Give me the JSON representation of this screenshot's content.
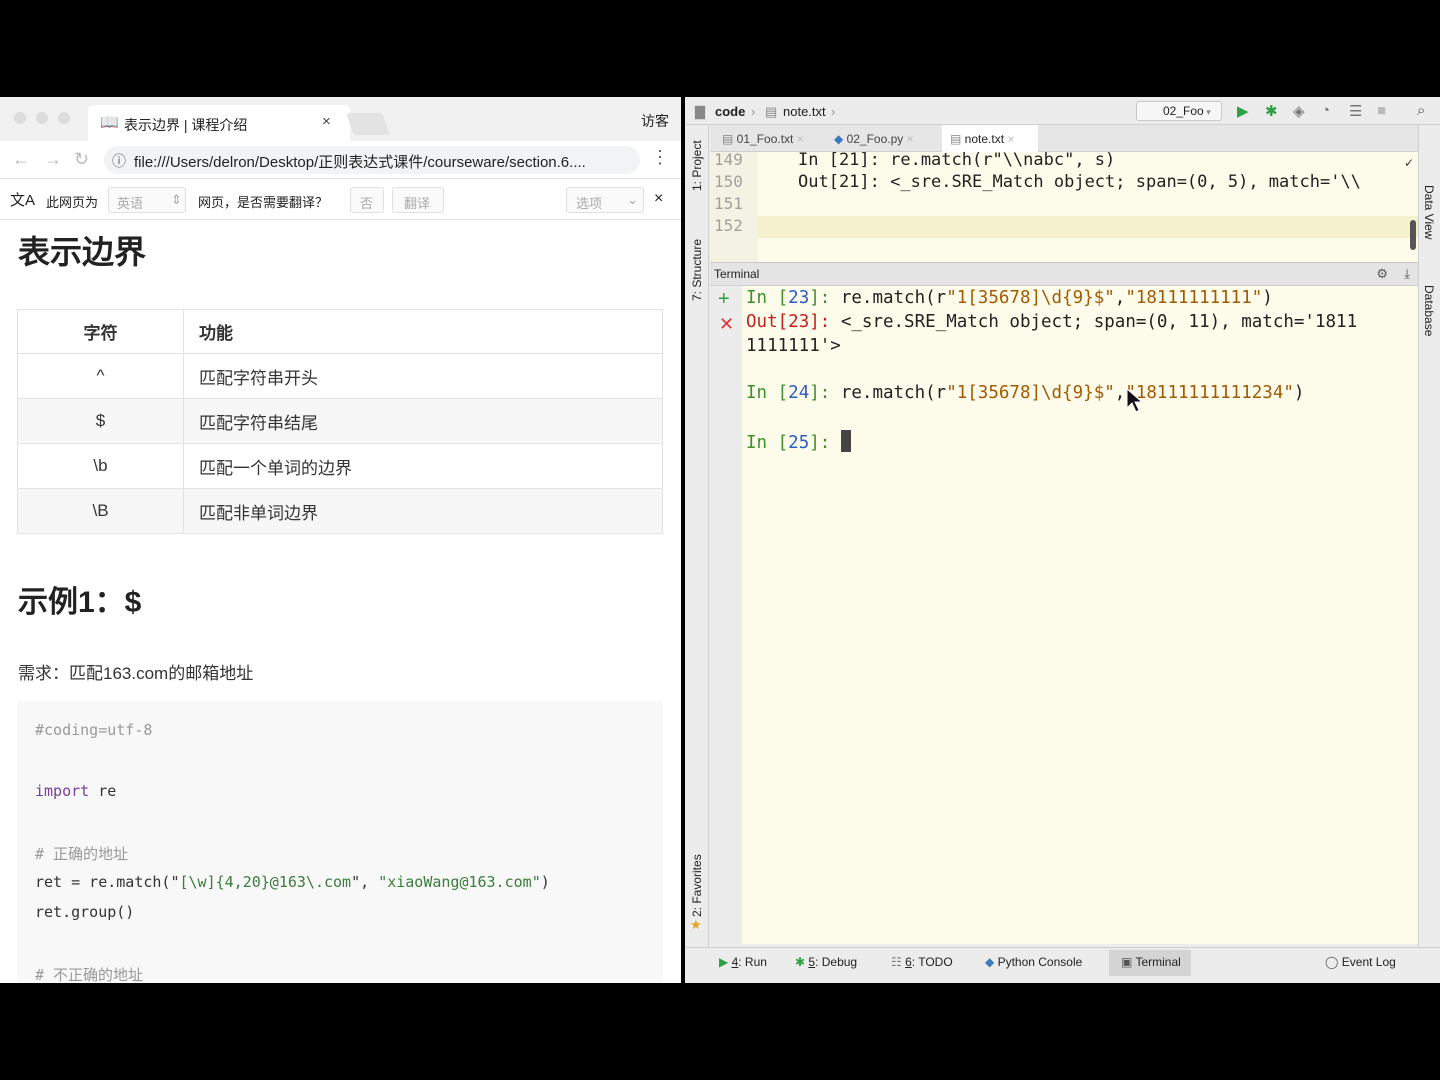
{
  "browser": {
    "tab_title": "表示边界 | 课程介绍",
    "tab_icon": "book-icon",
    "guest_label": "访客",
    "url": "file:///Users/delron/Desktop/正则表达式课件/courseware/section.6....",
    "translate": {
      "this_page_is": "此网页为",
      "language": "英语",
      "question": "网页，是否需要翻译？",
      "no_button": "否",
      "translate_button": "翻译",
      "options": "选项"
    }
  },
  "doc": {
    "title": "表示边界",
    "table": {
      "headers": [
        "字符",
        "功能"
      ],
      "rows": [
        [
          "^",
          "匹配字符串开头"
        ],
        [
          "$",
          "匹配字符串结尾"
        ],
        [
          "\\b",
          "匹配一个单词的边界"
        ],
        [
          "\\B",
          "匹配非单词边界"
        ]
      ]
    },
    "example_title": "示例1：$",
    "requirement": "需求：匹配163.com的邮箱地址",
    "code": {
      "coding": "#coding=utf-8",
      "import_kw": "import",
      "import_mod": " re",
      "comment_correct": "# 正确的地址",
      "line_ret_a": "ret = re.match(\"",
      "line_ret_pattern": "[\\w]{4,20}@163\\.com",
      "line_ret_b": "\", ",
      "line_ret_email": "\"xiaoWang@163.com\"",
      "line_ret_c": ")",
      "line_group": "ret.group()",
      "comment_incorrect": "# 不正确的地址"
    }
  },
  "ide": {
    "breadcrumb": [
      "code",
      "note.txt"
    ],
    "run_config": "02_Foo",
    "tabs": [
      "01_Foo.txt",
      "02_Foo.py",
      "note.txt"
    ],
    "left_strip": [
      "1: Project",
      "7: Structure",
      "2: Favorites"
    ],
    "right_strip": [
      "Data View",
      "Database"
    ],
    "editor_lines": [
      {
        "num": "149",
        "text": "In [21]: re.match(r\"\\\\nabc\", s)"
      },
      {
        "num": "150",
        "text": "Out[21]: <_sre.SRE_Match object; span=(0, 5), match='\\\\"
      },
      {
        "num": "151",
        "text": ""
      },
      {
        "num": "152",
        "text": ""
      }
    ],
    "terminal_title": "Terminal",
    "terminal": {
      "in23_prompt": "In [",
      "in23_num": "23",
      "in23_close": "]: ",
      "in23_code_a": "re.match(r",
      "in23_str": "\"1[35678]\\d{9}$\"",
      "in23_comma": ",",
      "in23_arg": "\"18111111111\"",
      "in23_end": ")",
      "out23_prompt": "Out[",
      "out23_num": "23",
      "out23_close": "]: ",
      "out23_text": "<_sre.SRE_Match object; span=(0, 11), match='1811",
      "out23_cont": "1111111'>",
      "in24_prompt": "In [",
      "in24_num": "24",
      "in24_close": "]: ",
      "in24_code_a": "re.match(r",
      "in24_str": "\"1[35678]\\d{9}$\"",
      "in24_comma": ",",
      "in24_arg": "\"18111111111234\"",
      "in24_end": ")",
      "in25_prompt": "In [",
      "in25_num": "25",
      "in25_close": "]: "
    },
    "bottom_tools": [
      {
        "key": "4",
        "label": ": Run"
      },
      {
        "key": "5",
        "label": ": Debug"
      },
      {
        "key": "6",
        "label": ": TODO"
      },
      {
        "key": "",
        "label": "Python Console"
      },
      {
        "key": "",
        "label": "Terminal"
      }
    ],
    "event_log": "Event Log"
  }
}
